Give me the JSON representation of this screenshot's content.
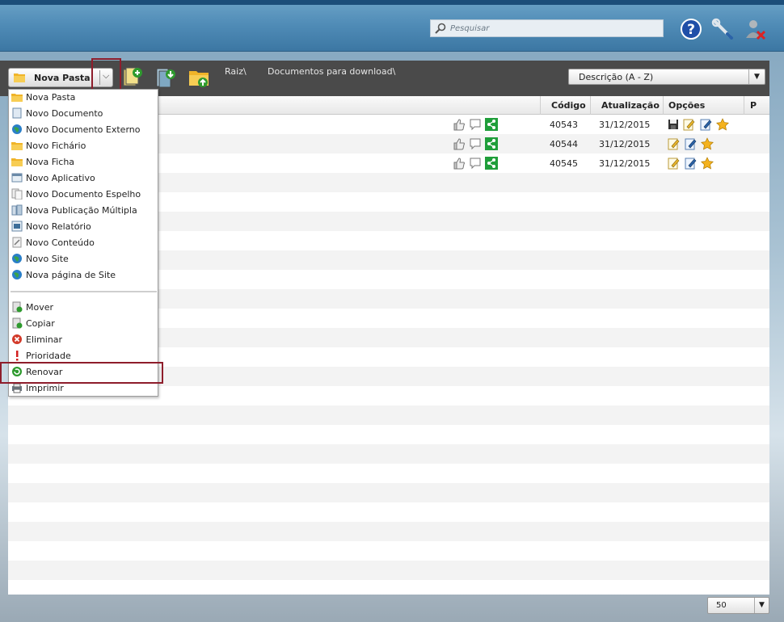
{
  "header": {
    "search_placeholder": "Pesquisar",
    "help_icon": "help-icon",
    "tools_icon": "wrench-icon",
    "logout_icon": "user-logout-icon"
  },
  "toolbar": {
    "new_folder_label": "Nova Pasta",
    "breadcrumb_root": "Raiz\\",
    "breadcrumb_folder": "Documentos para download\\",
    "sort_value": "Descrição (A - Z)"
  },
  "grid": {
    "columns": [
      "Código",
      "Atualização",
      "Opções",
      "P"
    ],
    "rows": [
      {
        "code": "40543",
        "date": "31/12/2015"
      },
      {
        "code": "40544",
        "date": "31/12/2015"
      },
      {
        "code": "40545",
        "date": "31/12/2015"
      }
    ]
  },
  "menu": {
    "items": [
      {
        "label": "Nova Pasta",
        "icon": "folder-icon"
      },
      {
        "label": "Novo Documento",
        "icon": "document-icon"
      },
      {
        "label": "Novo Documento Externo",
        "icon": "globe-document-icon"
      },
      {
        "label": "Novo Fichário",
        "icon": "folder-binder-icon"
      },
      {
        "label": "Nova Ficha",
        "icon": "folder-card-icon"
      },
      {
        "label": "Novo Aplicativo",
        "icon": "application-icon"
      },
      {
        "label": "Novo Documento Espelho",
        "icon": "mirror-document-icon"
      },
      {
        "label": "Nova Publicação Múltipla",
        "icon": "multiple-publication-icon"
      },
      {
        "label": "Novo Relatório",
        "icon": "report-icon"
      },
      {
        "label": "Novo Conteúdo",
        "icon": "content-icon"
      },
      {
        "label": "Novo Site",
        "icon": "globe-icon"
      },
      {
        "label": "Nova página de Site",
        "icon": "globe-page-icon"
      }
    ],
    "actions": [
      {
        "label": "Mover",
        "icon": "move-icon"
      },
      {
        "label": "Copiar",
        "icon": "copy-icon"
      },
      {
        "label": "Eliminar",
        "icon": "delete-icon"
      },
      {
        "label": "Prioridade",
        "icon": "priority-icon"
      },
      {
        "label": "Renovar",
        "icon": "renew-icon"
      },
      {
        "label": "Imprimir",
        "icon": "print-icon"
      }
    ]
  },
  "pager": {
    "page_size": "50"
  },
  "colors": {
    "header": "#4f8bb6",
    "toolbar": "#4a4a4a",
    "highlight": "#8e1d2b"
  }
}
